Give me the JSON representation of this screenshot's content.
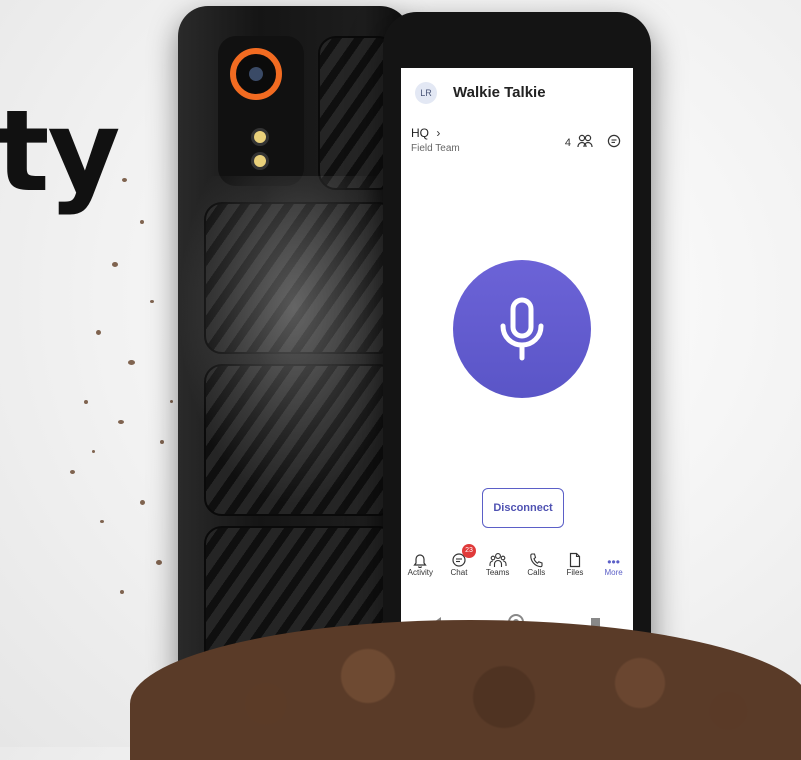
{
  "headline": "ty",
  "app": {
    "avatar_initials": "LR",
    "title": "Walkie Talkie",
    "channel": {
      "name": "HQ",
      "sub": "Field Team",
      "member_count": "4"
    },
    "disconnect_label": "Disconnect",
    "nav": [
      {
        "label": "Activity",
        "icon": "bell-icon"
      },
      {
        "label": "Chat",
        "icon": "chat-icon",
        "badge": "23"
      },
      {
        "label": "Teams",
        "icon": "teams-icon"
      },
      {
        "label": "Calls",
        "icon": "phone-icon"
      },
      {
        "label": "Files",
        "icon": "file-icon"
      },
      {
        "label": "More",
        "icon": "more-icon",
        "active": true
      }
    ]
  },
  "colors": {
    "accent": "#5b5fc7",
    "device_accent": "#f26b21",
    "badge": "#e03a3a"
  }
}
